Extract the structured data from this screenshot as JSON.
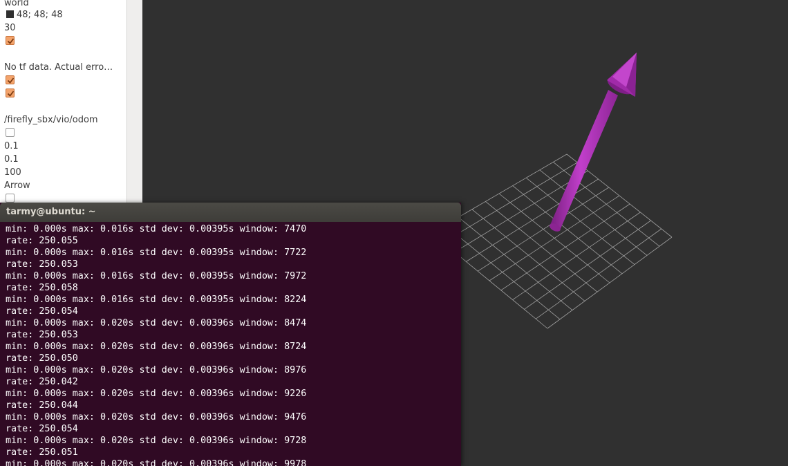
{
  "panel": {
    "fixed_frame": "world",
    "background_color": "48; 48; 48",
    "frame_rate": "30",
    "global_status": "No tf data.  Actual erro…",
    "odometry_topic": "/firefly_sbx/vio/odom",
    "position_tolerance": "0.1",
    "angle_tolerance": "0.1",
    "keep": "100",
    "shape": "Arrow",
    "checkboxes": [
      {
        "checked": true
      },
      {
        "checked": true
      },
      {
        "checked": true
      },
      {
        "checked": false
      },
      {
        "checked": false
      }
    ]
  },
  "view3d": {
    "background": "#303030",
    "grid_color": "#a0a0a0",
    "arrow_color": "#b52fbe"
  },
  "terminal": {
    "title": "tarmy@ubuntu: ~",
    "lines": [
      "min: 0.000s max: 0.016s std dev: 0.00395s window: 7470",
      "rate: 250.055",
      "min: 0.000s max: 0.016s std dev: 0.00395s window: 7722",
      "rate: 250.053",
      "min: 0.000s max: 0.016s std dev: 0.00395s window: 7972",
      "rate: 250.058",
      "min: 0.000s max: 0.016s std dev: 0.00395s window: 8224",
      "rate: 250.054",
      "min: 0.000s max: 0.020s std dev: 0.00396s window: 8474",
      "rate: 250.053",
      "min: 0.000s max: 0.020s std dev: 0.00396s window: 8724",
      "rate: 250.050",
      "min: 0.000s max: 0.020s std dev: 0.00396s window: 8976",
      "rate: 250.042",
      "min: 0.000s max: 0.020s std dev: 0.00396s window: 9226",
      "rate: 250.044",
      "min: 0.000s max: 0.020s std dev: 0.00396s window: 9476",
      "rate: 250.054",
      "min: 0.000s max: 0.020s std dev: 0.00396s window: 9728",
      "rate: 250.051",
      "min: 0.000s max: 0.020s std dev: 0.00396s window: 9978"
    ]
  }
}
